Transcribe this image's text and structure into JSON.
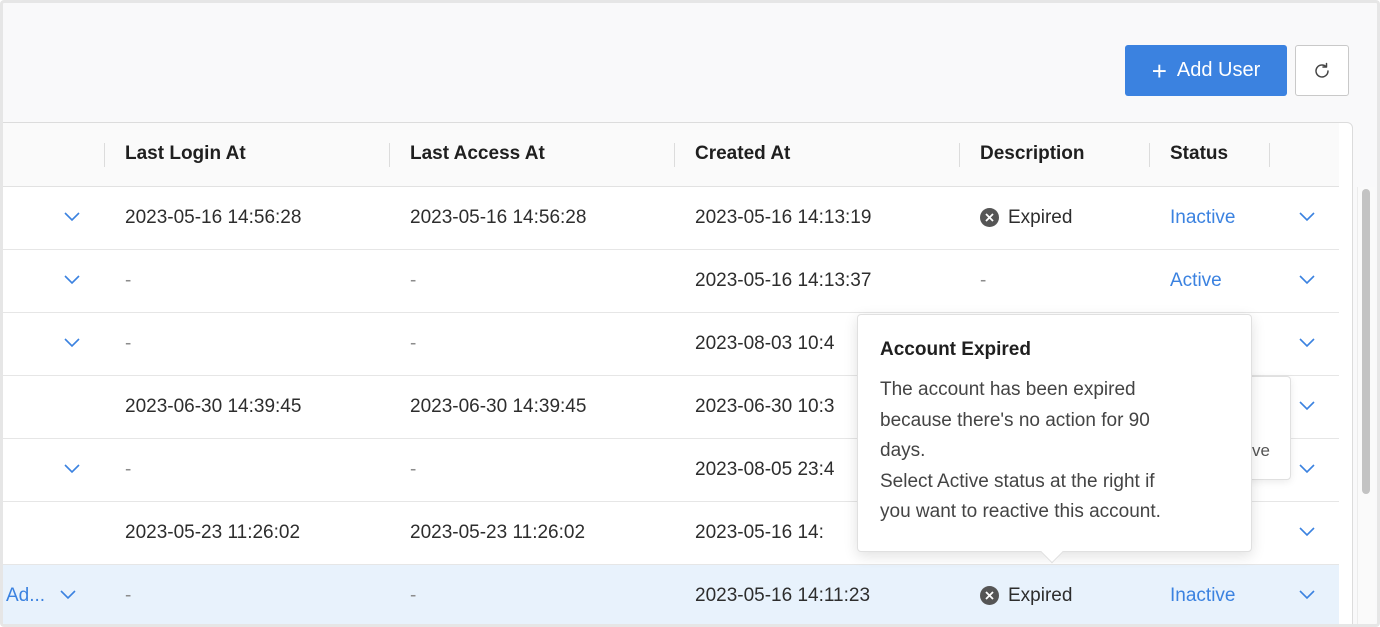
{
  "toolbar": {
    "add_user_label": "Add User",
    "add_icon": "plus-icon",
    "refresh_icon": "refresh-icon"
  },
  "table": {
    "columns": [
      "Last Login At",
      "Last Access At",
      "Created At",
      "Description",
      "Status"
    ],
    "rows": [
      {
        "prefix": "",
        "last_login": "2023-05-16 14:56:28",
        "last_access": "2023-05-16 14:56:28",
        "created": "2023-05-16 14:13:19",
        "description": "Expired",
        "status": "Inactive"
      },
      {
        "prefix": "",
        "last_login": "-",
        "last_access": "-",
        "created": "2023-05-16 14:13:37",
        "description": "-",
        "status": "Active"
      },
      {
        "prefix": "",
        "last_login": "-",
        "last_access": "-",
        "created": "2023-08-03 10:4",
        "description": "",
        "status": ""
      },
      {
        "prefix": "",
        "last_login": "2023-06-30 14:39:45",
        "last_access": "2023-06-30 14:39:45",
        "created": "2023-06-30 10:3",
        "description": "",
        "status": ""
      },
      {
        "prefix": "",
        "last_login": "-",
        "last_access": "-",
        "created": "2023-08-05 23:4",
        "description": "",
        "status": ""
      },
      {
        "prefix": "",
        "last_login": "2023-05-23 11:26:02",
        "last_access": "2023-05-23 11:26:02",
        "created": "2023-05-16 14:",
        "description": "",
        "status": ""
      },
      {
        "prefix": "Ad...",
        "last_login": "-",
        "last_access": "-",
        "created": "2023-05-16 14:11:23",
        "description": "Expired",
        "status": "Inactive"
      }
    ]
  },
  "tooltip": {
    "title": "Account Expired",
    "body_line1": "The account has been expired",
    "body_line2": "because there's no action for 90",
    "body_line3": "days.",
    "body_line4": "Select Active status at the right if",
    "body_line5": "you want to reactive this account."
  },
  "ghost_menu": {
    "partial_text": "ve"
  },
  "colors": {
    "accent": "#3b82e0",
    "selected_row": "#e8f2fc"
  }
}
